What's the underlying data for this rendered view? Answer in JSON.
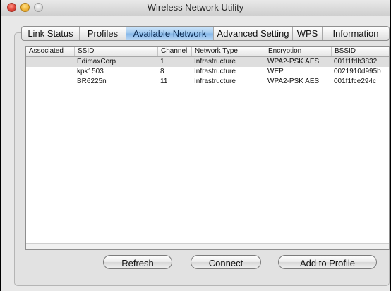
{
  "window": {
    "title": "Wireless Network Utility"
  },
  "tabs": [
    {
      "label": "Link Status"
    },
    {
      "label": "Profiles"
    },
    {
      "label": "Available Network",
      "active": true
    },
    {
      "label": "Advanced Setting"
    },
    {
      "label": "WPS"
    },
    {
      "label": "Information"
    }
  ],
  "table": {
    "columns": [
      "Associated",
      "SSID",
      "Channel",
      "Network Type",
      "Encryption",
      "BSSID"
    ],
    "rows": [
      {
        "associated": "",
        "ssid": "EdimaxCorp",
        "channel": "1",
        "network_type": "Infrastructure",
        "encryption": "WPA2-PSK AES",
        "bssid": "001f1fdb3832",
        "selected": true
      },
      {
        "associated": "",
        "ssid": "kpk1503",
        "channel": "8",
        "network_type": "Infrastructure",
        "encryption": "WEP",
        "bssid": "0021910d995b"
      },
      {
        "associated": "",
        "ssid": "BR6225n",
        "channel": "11",
        "network_type": "Infrastructure",
        "encryption": "WPA2-PSK AES",
        "bssid": "001f1fce294c"
      }
    ]
  },
  "buttons": {
    "refresh": "Refresh",
    "connect": "Connect",
    "add_to_profile": "Add to Profile"
  }
}
